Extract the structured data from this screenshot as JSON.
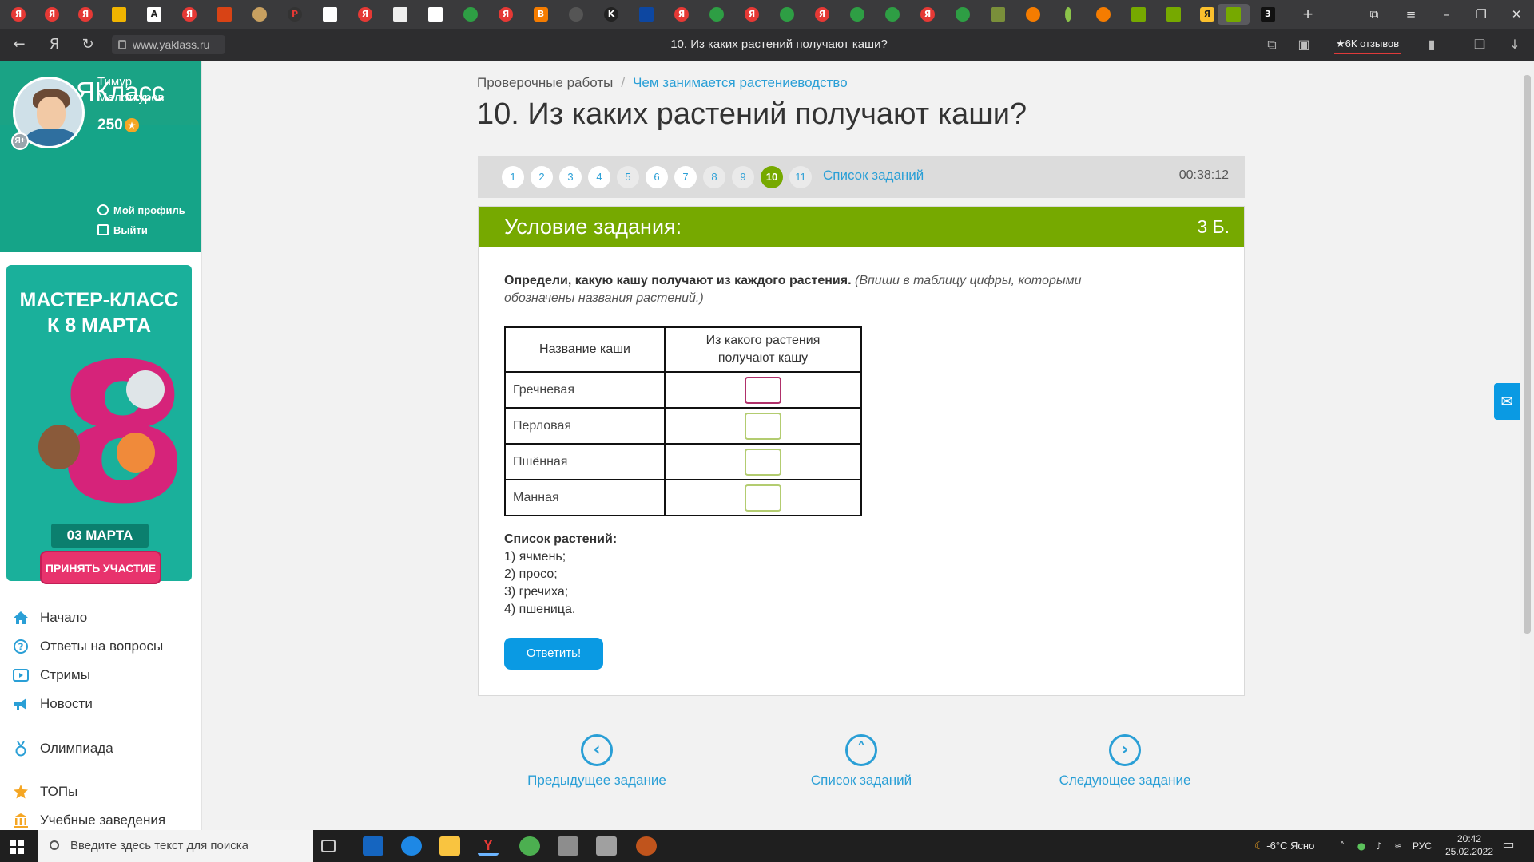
{
  "browser": {
    "url": "www.yaklass.ru",
    "tab_title": "10. Из каких растений получают каши?",
    "reviews": "★6К отзывов"
  },
  "sidebar": {
    "logo": "ЯКласс",
    "user": {
      "first_name": "Тимур",
      "last_name": "Малоткуров",
      "points": "250",
      "profile_link": "Мой профиль",
      "logout_link": "Выйти"
    },
    "promo": {
      "title_line1": "МАСТЕР-КЛАСС",
      "title_line2": "К 8 МАРТА",
      "big_number": "8",
      "date": "03 МАРТА",
      "button": "ПРИНЯТЬ УЧАСТИЕ"
    },
    "nav": [
      {
        "label": "Начало",
        "icon": "home-icon"
      },
      {
        "label": "Ответы на вопросы",
        "icon": "question-icon"
      },
      {
        "label": "Стримы",
        "icon": "play-icon"
      },
      {
        "label": "Новости",
        "icon": "megaphone-icon"
      },
      {
        "label": "Олимпиада",
        "icon": "medal-icon"
      },
      {
        "label": "ТОПы",
        "icon": "star-icon"
      },
      {
        "label": "Учебные заведения",
        "icon": "building-icon"
      }
    ]
  },
  "main": {
    "breadcrumb": [
      "Проверочные работы",
      "Чем занимается растениеводство"
    ],
    "title": "10. Из каких растений получают каши?",
    "question_nav": {
      "numbers": [
        "1",
        "2",
        "3",
        "4",
        "5",
        "6",
        "7",
        "8",
        "9",
        "10",
        "11"
      ],
      "current": "10",
      "list_link": "Список заданий",
      "timer": "00:38:12"
    },
    "task": {
      "header": "Условие задания:",
      "points": "3 Б.",
      "instruction_bold": "Определи, какую кашу получают из каждого растения.",
      "instruction_italic": "(Впиши в таблицу цифры, которыми обозначены названия растений.)",
      "table": {
        "col1": "Название каши",
        "col2_line1": "Из какого растения",
        "col2_line2": "получают кашу",
        "rows": [
          {
            "name": "Гречневая",
            "value": ""
          },
          {
            "name": "Перловая",
            "value": ""
          },
          {
            "name": "Пшённая",
            "value": ""
          },
          {
            "name": "Манная",
            "value": ""
          }
        ]
      },
      "plants_title": "Список растений:",
      "plants": [
        "1) ячмень;",
        "2) просо;",
        "3) гречиха;",
        "4) пшеница."
      ],
      "submit": "Ответить!"
    },
    "bottom_nav": {
      "prev": "Предыдущее задание",
      "list": "Список заданий",
      "next": "Следующее задание"
    }
  },
  "taskbar": {
    "search_placeholder": "Введите здесь текст для поиска",
    "weather": "-6°C  Ясно",
    "lang": "РУС",
    "time": "20:42",
    "date": "25.02.2022"
  },
  "colors": {
    "brand_teal": "#1aa385",
    "task_green": "#76a900",
    "link_blue": "#2a9fd6",
    "button_blue": "#0a9ae3",
    "promo_pink": "#e8336d"
  }
}
